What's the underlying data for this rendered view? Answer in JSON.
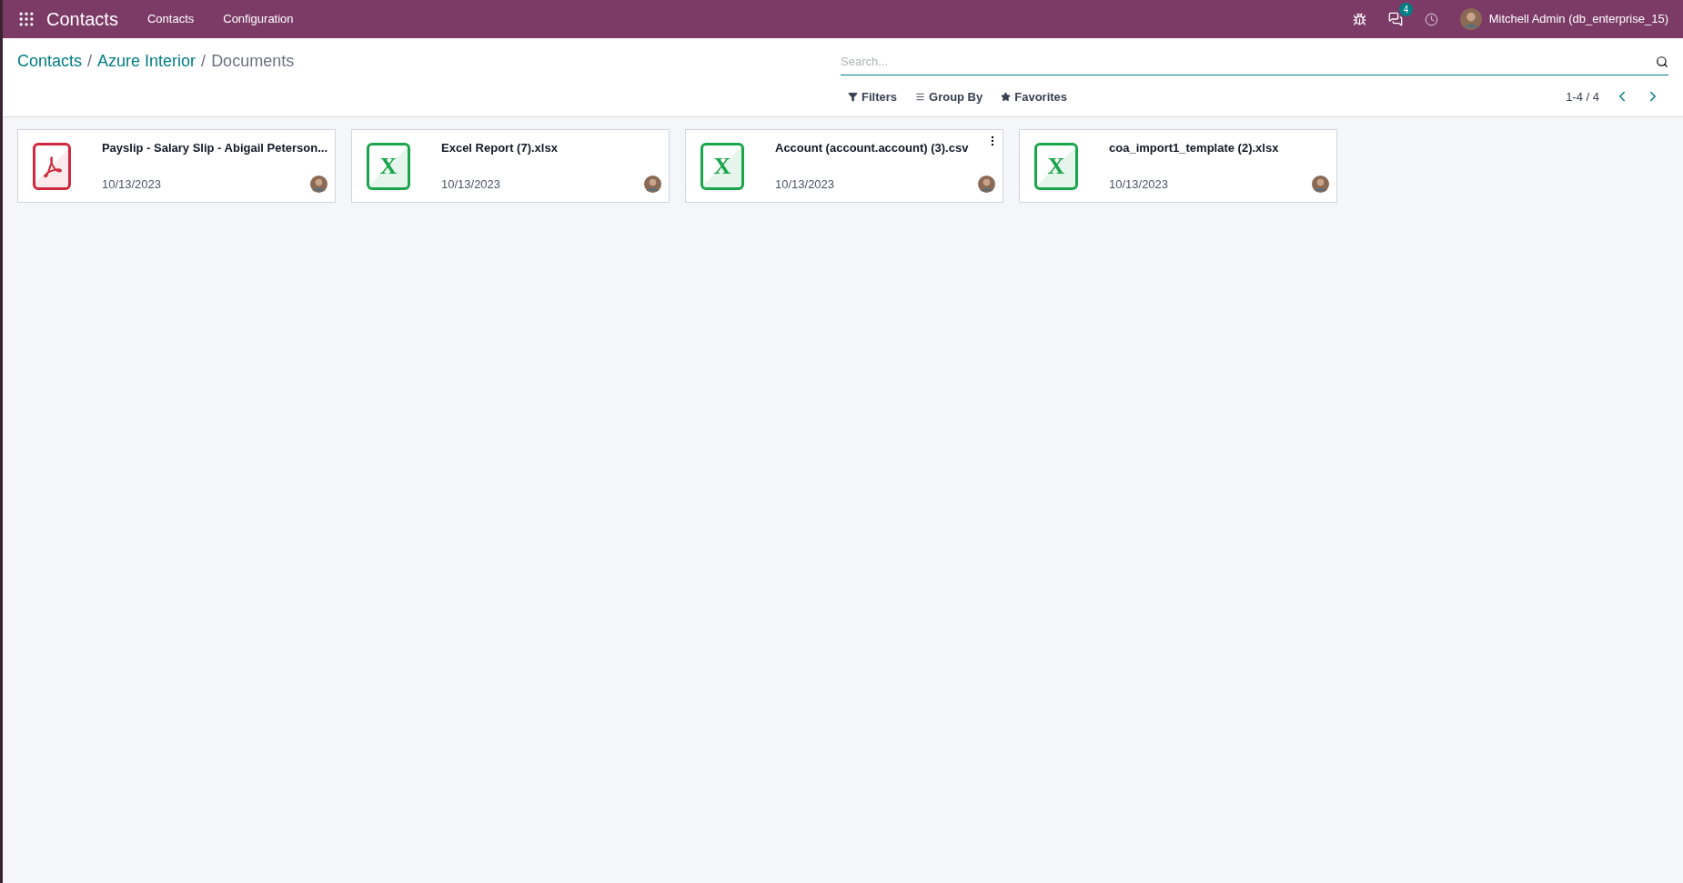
{
  "navbar": {
    "app_name": "Contacts",
    "menu": [
      "Contacts",
      "Configuration"
    ],
    "messages_badge": "4",
    "user": "Mitchell Admin (db_enterprise_15)"
  },
  "breadcrumb": [
    {
      "label": "Contacts",
      "kind": "link"
    },
    {
      "label": "/",
      "kind": "separator"
    },
    {
      "label": "Azure Interior",
      "kind": "link"
    },
    {
      "label": "/",
      "kind": "separator"
    },
    {
      "label": "Documents",
      "kind": "current"
    }
  ],
  "search": {
    "placeholder": "Search..."
  },
  "filters": [
    "Filters",
    "Group By",
    "Favorites"
  ],
  "pager": "1-4 / 4",
  "documents": [
    {
      "kind": "pdf",
      "name": "Payslip - Salary Slip - Abigail Peterson...",
      "date": "10/13/2023",
      "menu_shown": false
    },
    {
      "kind": "spreadsheet",
      "icon_letter": "X",
      "name": "Excel Report (7).xlsx",
      "date": "10/13/2023",
      "menu_shown": false
    },
    {
      "kind": "spreadsheet",
      "icon_letter": "X",
      "name": "Account (account.account) (3).csv",
      "date": "10/13/2023",
      "menu_shown": true
    },
    {
      "kind": "spreadsheet",
      "icon_letter": "X",
      "name": "coa_import1_template (2).xlsx",
      "date": "10/13/2023",
      "menu_shown": false
    }
  ]
}
